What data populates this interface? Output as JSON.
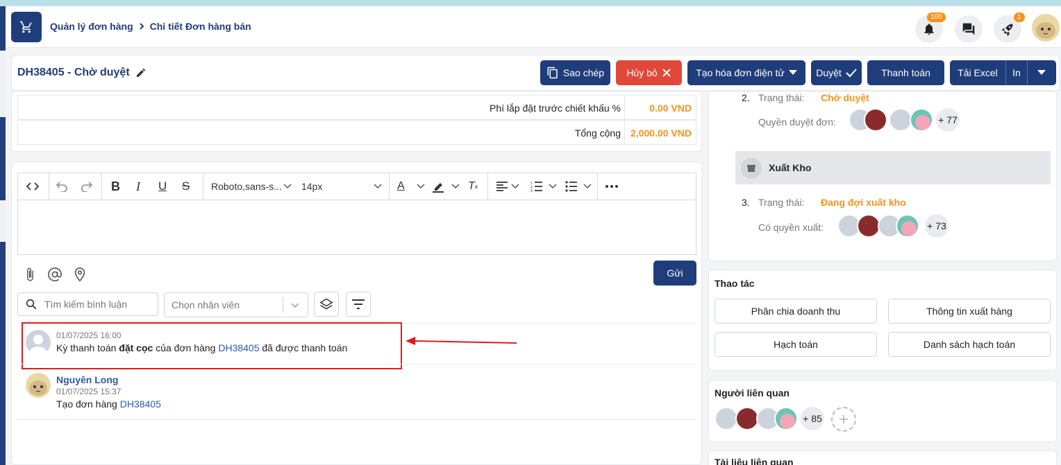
{
  "header": {
    "breadcrumb": [
      "Quản lý đơn hàng",
      "Chi tiết Đơn hàng bán"
    ],
    "notifications_badge": "100",
    "rocket_badge": "1"
  },
  "order": {
    "title": "DH38405 - Chờ duyệt",
    "actions": {
      "copy": "Sao chép",
      "cancel": "Hủy bỏ",
      "einvoice": "Tạo hóa đơn điện tử",
      "approve": "Duyệt",
      "pay": "Thanh toán",
      "excel": "Tải Excel",
      "print": "In"
    }
  },
  "totals": [
    {
      "label": "Phí lắp đặt trước chiết khấu %",
      "value": "0.00 VND"
    },
    {
      "label": "Tổng cộng",
      "value": "2,000.00 VND"
    }
  ],
  "editor": {
    "font": "Roboto,sans-s...",
    "size": "14px",
    "send": "Gửi"
  },
  "comments_filter": {
    "search_placeholder": "Tìm kiếm bình luận",
    "staff_placeholder": "Chọn nhân viên"
  },
  "comments": [
    {
      "time": "01/07/2025 16:00",
      "text_before": "Kỳ thanh toán ",
      "text_bold": "đặt cọc",
      "text_mid": " của đơn hàng ",
      "link": "DH38405",
      "text_after": " đã được thanh toán"
    },
    {
      "author": "Nguyên Long",
      "time": "01/07/2025 15:37",
      "text_before": "Tạo đơn hàng ",
      "link": "DH38405"
    }
  ],
  "workflow": {
    "step2": {
      "index": "2.",
      "status_label": "Trạng thái:",
      "status": "Chờ duyệt",
      "perm_label": "Quyền duyệt đơn:",
      "more": "+ 77"
    },
    "section": "Xuất Kho",
    "step3": {
      "index": "3.",
      "status_label": "Trạng thái:",
      "status": "Đang đợi xuất kho",
      "perm_label": "Có quyền xuất:",
      "more": "+ 73"
    }
  },
  "operations": {
    "title": "Thao tác",
    "buttons": [
      "Phân chia doanh thu",
      "Thông tin xuất hàng",
      "Hạch toán",
      "Danh sách hạch toán"
    ]
  },
  "related_people": {
    "title": "Người liên quan",
    "more": "+ 85"
  },
  "related_docs": {
    "title": "Tài liệu liên quan"
  },
  "colors": {
    "primary": "#1f3d7a",
    "accent": "#f5921e",
    "danger": "#e0483a",
    "highlight_box": "#e01b1b"
  }
}
